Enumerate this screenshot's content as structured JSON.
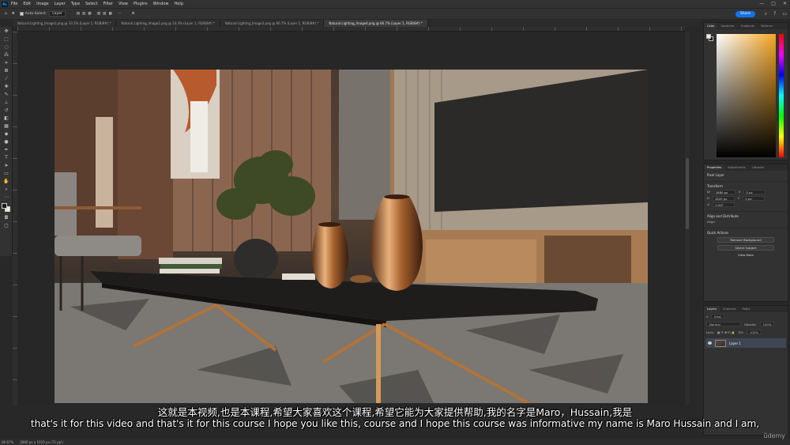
{
  "menubar": {
    "logo": "Ps",
    "items": [
      "File",
      "Edit",
      "Image",
      "Layer",
      "Type",
      "Select",
      "Filter",
      "View",
      "Plugins",
      "Window",
      "Help"
    ],
    "window_controls": [
      "—",
      "□",
      "✕"
    ]
  },
  "options": {
    "auto_select_label": "Auto-Select:",
    "auto_select_value": "Layer",
    "share_label": "Share"
  },
  "tabs": [
    "Natural Lighting_Image1.png @ 33.3% (Layer 1, RGB/8#) *",
    "Natural Lighting_Image2.png @ 33.3% (Layer 1, RGB/8#) *",
    "Natural Lighting_Image3.png @ 66.7% (Layer 1, RGB/8#) *",
    "Natural Lighting_Image4.png @ 66.7% (Layer 1, RGB/8#) *"
  ],
  "active_tab": 3,
  "status": {
    "zoom": "66.67%",
    "doc_size": "2880 px x 1620 px (72 ppi)"
  },
  "color_panel": {
    "tabs": [
      "Color",
      "Swatches",
      "Gradients",
      "Patterns"
    ]
  },
  "properties_panel": {
    "tabs": [
      "Properties",
      "Adjustments",
      "Libraries"
    ],
    "layer_type": "Pixel Layer",
    "transform_title": "Transform",
    "w_value": "2880 px",
    "h_value": "1620 px",
    "x_value": "0 px",
    "y_value": "0 px",
    "angle_value": "0.00°",
    "align_title": "Align and Distribute",
    "align_sub": "Align:",
    "quick_actions_title": "Quick Actions",
    "qa_buttons": [
      "Remove Background",
      "Select Subject"
    ],
    "view_more": "View More"
  },
  "layers_panel": {
    "tabs": [
      "Layers",
      "Channels",
      "Paths"
    ],
    "kind_label": "Kind",
    "blend_mode": "Normal",
    "opacity_label": "Opacity:",
    "opacity_value": "100%",
    "lock_label": "Lock:",
    "fill_label": "Fill:",
    "fill_value": "100%",
    "layer_name": "Layer 1"
  },
  "subtitles": {
    "zh": "这就是本视频,也是本课程,希望大家喜欢这个课程,希望它能为大家提供帮助,我的名字是Maro，Hussain,我是",
    "en": "that's it for this video and that's it for this course I hope you like this, course and I hope this course was informative my name is Maro Hussain and I am,"
  },
  "watermark": "ûdemy",
  "icons": {
    "move_tool": "move-icon",
    "search": "search-icon",
    "eye": "eye-icon"
  }
}
